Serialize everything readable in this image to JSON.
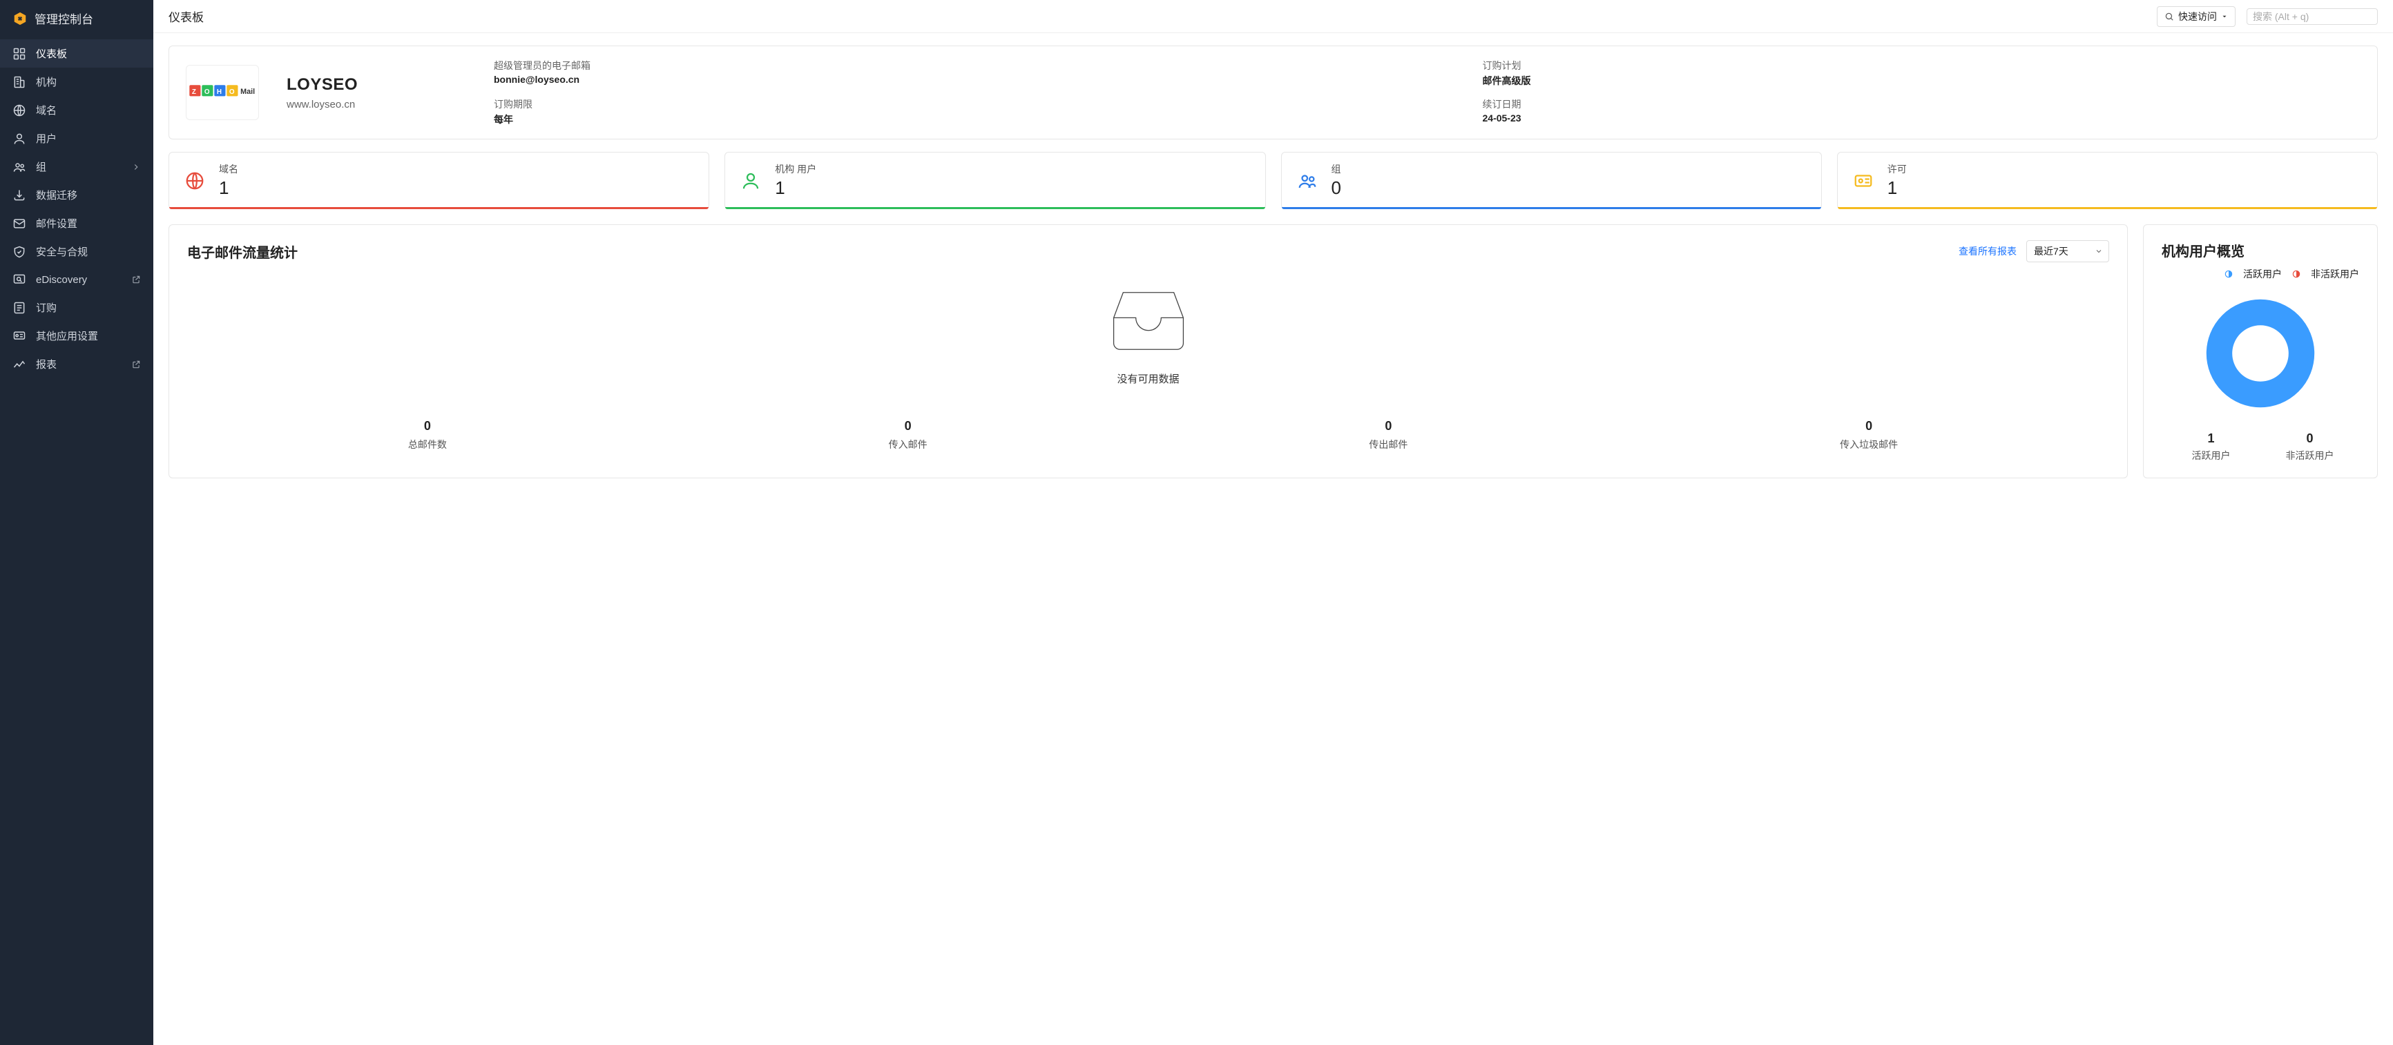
{
  "sidebar": {
    "title": "管理控制台",
    "items": [
      {
        "label": "仪表板"
      },
      {
        "label": "机构"
      },
      {
        "label": "域名"
      },
      {
        "label": "用户"
      },
      {
        "label": "组"
      },
      {
        "label": "数据迁移"
      },
      {
        "label": "邮件设置"
      },
      {
        "label": "安全与合规"
      },
      {
        "label": "eDiscovery"
      },
      {
        "label": "订购"
      },
      {
        "label": "其他应用设置"
      },
      {
        "label": "报表"
      }
    ]
  },
  "topbar": {
    "title": "仪表板",
    "quick_access": "快速访问",
    "search_placeholder": "搜索 (Alt + q)"
  },
  "org": {
    "logo_text": "ZOHO Mail",
    "name": "LOYSEO",
    "domain": "www.loyseo.cn",
    "meta": {
      "admin_email_label": "超级管理员的电子邮箱",
      "admin_email": "bonnie@loyseo.cn",
      "plan_label": "订购计划",
      "plan": "邮件高级版",
      "period_label": "订购期限",
      "period": "每年",
      "renew_label": "续订日期",
      "renew": "24-05-23"
    }
  },
  "stats": {
    "domains": {
      "label": "域名",
      "value": "1"
    },
    "users": {
      "label": "机构 用户",
      "value": "1"
    },
    "groups": {
      "label": "组",
      "value": "0"
    },
    "licenses": {
      "label": "许可",
      "value": "1"
    }
  },
  "traffic": {
    "title": "电子邮件流量统计",
    "view_all": "查看所有报表",
    "range": "最近7天",
    "empty_text": "没有可用数据",
    "items": [
      {
        "value": "0",
        "label": "总邮件数"
      },
      {
        "value": "0",
        "label": "传入邮件"
      },
      {
        "value": "0",
        "label": "传出邮件"
      },
      {
        "value": "0",
        "label": "传入垃圾邮件"
      }
    ]
  },
  "overview": {
    "title": "机构用户概览",
    "legend": {
      "active": "活跃用户",
      "inactive": "非活跃用户"
    },
    "active": {
      "value": "1",
      "label": "活跃用户"
    },
    "inactive": {
      "value": "0",
      "label": "非活跃用户"
    }
  },
  "colors": {
    "active": "#3a9cff",
    "inactive": "#e74c3c"
  }
}
